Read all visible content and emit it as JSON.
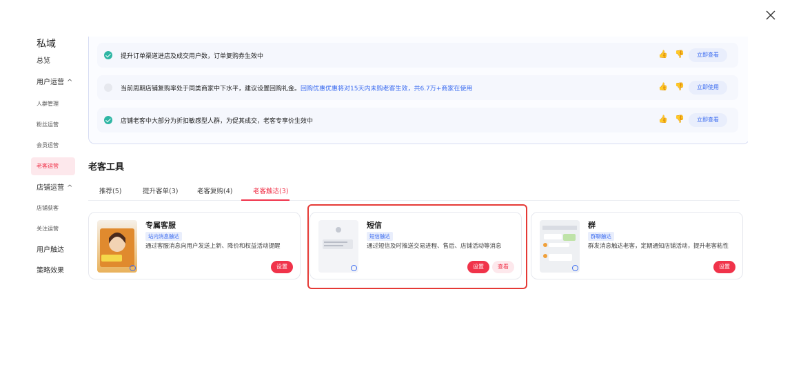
{
  "sidebar": {
    "title": "私域",
    "items": [
      {
        "label": "总览"
      },
      {
        "label": "用户运营",
        "chevron": "^"
      },
      {
        "label": "人群管理"
      },
      {
        "label": "粉丝运营"
      },
      {
        "label": "会员运营"
      },
      {
        "label": "老客运营",
        "active": true
      },
      {
        "label": "店铺运营",
        "chevron": "^"
      },
      {
        "label": "店铺获客"
      },
      {
        "label": "关注运营"
      },
      {
        "label": "用户触达"
      },
      {
        "label": "策略效果"
      }
    ]
  },
  "alerts": [
    {
      "text": "提升订单渠道进店及成交用户数，订单复购券生效中",
      "highlight": "",
      "action": "立即查看",
      "checked": true
    },
    {
      "text": "当前周期店铺复购率处于同类商家中下水平，建议设置回购礼金。",
      "highlight": "回购优惠优惠将对15天内未购老客生效，共6.7万+商家在使用",
      "action": "立即使用",
      "checked": false
    },
    {
      "text": "店铺老客中大部分为折扣敏感型人群，为促其成交，老客专享价生效中",
      "highlight": "",
      "action": "立即查看",
      "checked": true
    }
  ],
  "section": {
    "title": "老客工具",
    "tabs": [
      "推荐(5)",
      "提升客单(3)",
      "老客复购(4)",
      "老客触达(3)"
    ],
    "active_tab": "老客触达(3)"
  },
  "cards": [
    {
      "title": "专属客服",
      "tag": "站内消息触达",
      "desc": "通过客服消息向用户发送上新、降价和权益活动提醒",
      "set_label": "设置"
    },
    {
      "title": "短信",
      "tag": "短信触达",
      "desc": "通过短信及时推送交易进程、售后、店铺活动等消息",
      "set_label": "设置",
      "view_label": "查看"
    },
    {
      "title": "群",
      "tag": "群聊触达",
      "desc": "群发消息触达老客，定期通知店铺活动，提升老客粘性",
      "set_label": "设置"
    }
  ],
  "colors": {
    "accent": "#f0334a",
    "link": "#3a6bf0",
    "highlight_box": "#e53935"
  }
}
